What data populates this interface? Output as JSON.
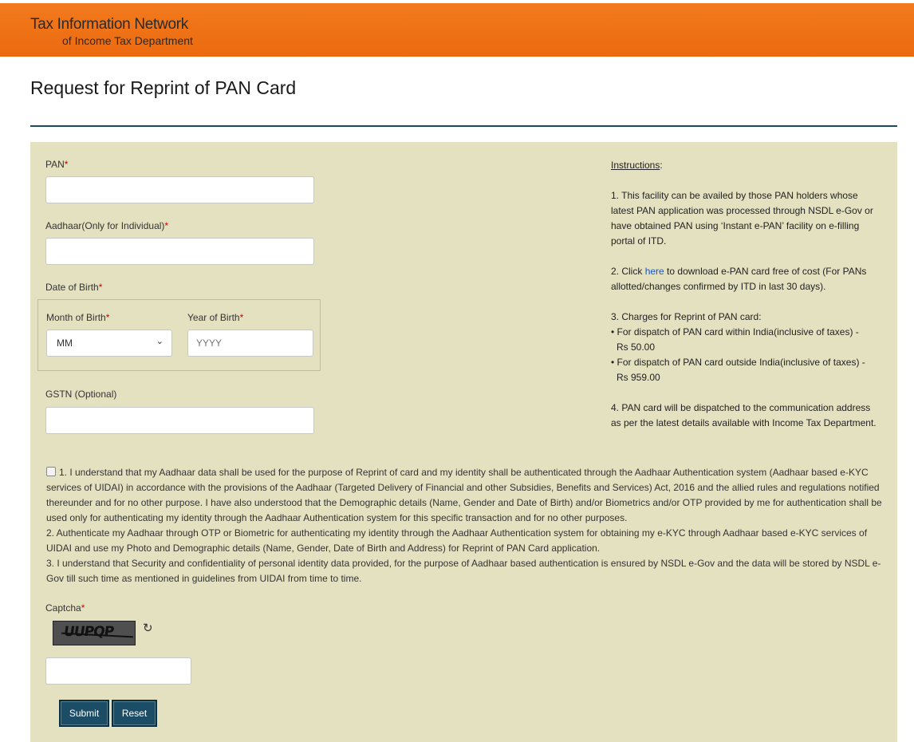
{
  "header": {
    "brand_line1": "Tax Information Network",
    "brand_line2": "of Income Tax Department"
  },
  "page": {
    "title": "Request for Reprint of PAN Card"
  },
  "form": {
    "required_mark": "*",
    "pan": {
      "label": "PAN",
      "value": ""
    },
    "aadhaar": {
      "label": "Aadhaar(Only for Individual)",
      "value": ""
    },
    "dob": {
      "label": "Date of Birth",
      "month": {
        "label": "Month of Birth",
        "selected": "MM"
      },
      "year": {
        "label": "Year of Birth",
        "placeholder": "YYYY",
        "value": ""
      }
    },
    "gstn": {
      "label": "GSTN (Optional)",
      "value": ""
    },
    "consent": {
      "checked": false,
      "para1": "1. I understand that my Aadhaar data shall be used for the purpose of Reprint of card and my identity shall be authenticated through the Aadhaar Authentication system (Aadhaar based e-KYC services of UIDAI) in accordance with the provisions of the Aadhaar (Targeted Delivery of Financial and other Subsidies, Benefits and Services) Act, 2016 and the allied rules and regulations notified thereunder and for no other purpose. I have also understood that the Demographic details (Name, Gender and Date of Birth) and/or Biometrics and/or OTP provided by me for authentication shall be used only for authenticating my identity through the Aadhaar Authentication system for this specific transaction and for no other purposes.",
      "para2": "2. Authenticate my Aadhaar through OTP or Biometric for authenticating my identity through the Aadhaar Authentication system for obtaining my e-KYC through Aadhaar based e-KYC services of UIDAI and use my Photo and Demographic details (Name, Gender, Date of Birth and Address) for Reprint of PAN Card application.",
      "para3": "3. I understand that Security and confidentiality of personal identity data provided, for the purpose of Aadhaar based authentication is ensured by NSDL e-Gov and the data will be stored by NSDL e-Gov till such time as mentioned in guidelines from UIDAI from time to time."
    },
    "captcha": {
      "label": "Captcha",
      "image_text": "UUPQP",
      "refresh_icon": "refresh-icon",
      "value": ""
    },
    "buttons": {
      "submit": "Submit",
      "reset": "Reset"
    }
  },
  "instructions": {
    "heading": "Instructions",
    "heading_suffix": ":",
    "item1": "1. This facility can be availed by those PAN holders whose latest PAN application was processed through NSDL e-Gov or have obtained PAN using ‘Instant e-PAN’ facility on e-filling portal of ITD.",
    "item2_prefix": "2. Click ",
    "item2_link": "here",
    "item2_suffix": " to download e-PAN card free of cost (For PANs allotted/changes confirmed by ITD in last 30 days).",
    "item3_title": "3. Charges for Reprint of PAN card:",
    "item3_line1": "• For dispatch of PAN card within India(inclusive of taxes) -",
    "item3_line1_amount": "Rs 50.00",
    "item3_line2": "• For dispatch of PAN card outside India(inclusive of taxes) -",
    "item3_line2_amount": "Rs 959.00",
    "item4": "4. PAN card will be dispatched to the communication address as per the latest details available with Income Tax Department."
  },
  "colors": {
    "header_orange": "#ee6f14",
    "panel_bg": "#e4e1c1",
    "button_bg": "#1b4e66",
    "required_red": "#cc0000",
    "link_blue": "#1a55c5"
  }
}
